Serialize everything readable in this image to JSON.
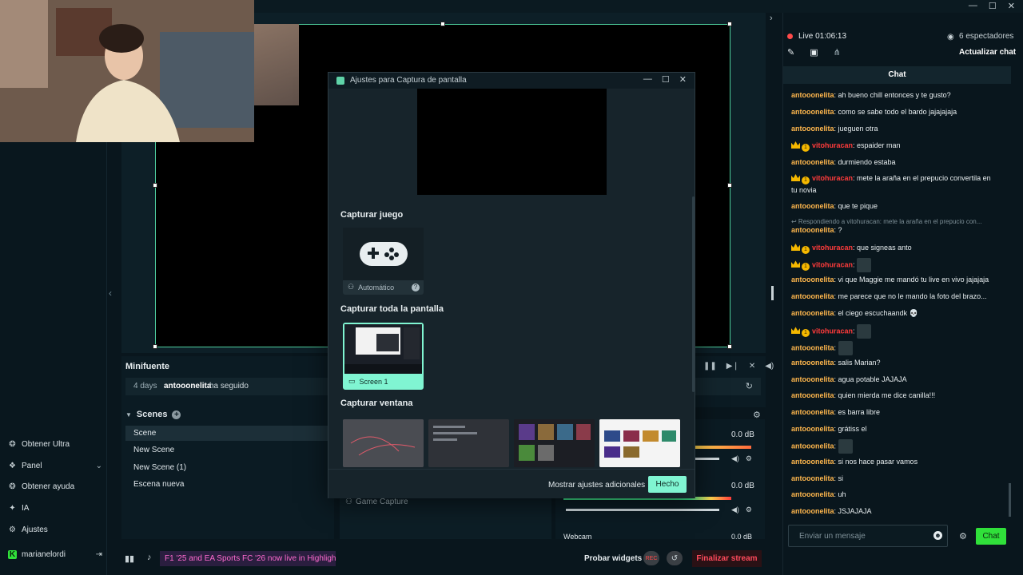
{
  "window": {
    "minimize": "—",
    "maximize": "☐",
    "close": "✕"
  },
  "nav": {
    "items": [
      {
        "label": "Obtener Ultra",
        "icon": "ultra-icon"
      },
      {
        "label": "Panel",
        "icon": "panel-icon"
      },
      {
        "label": "Obtener ayuda",
        "icon": "help-icon"
      },
      {
        "label": "IA",
        "icon": "ai-icon"
      },
      {
        "label": "Ajustes",
        "icon": "gear-icon"
      }
    ],
    "user": "marianelordi"
  },
  "minifuente": {
    "title": "Minifuente",
    "event_time": "4 days",
    "event_user": "antooonelita",
    "event_text": "ha seguido"
  },
  "scenes": {
    "title": "Scenes",
    "items": [
      "Scene",
      "New Scene",
      "New Scene (1)",
      "Escena nueva"
    ]
  },
  "sources": {
    "item": "Game Capture"
  },
  "mixer": {
    "db1": "0.0 dB",
    "db2": "0.0 dB",
    "db3": "0.0 dB",
    "label3": "Webcam"
  },
  "bottom": {
    "banner": "F1 '25 and EA Sports FC '26 now live in Highlighter!",
    "probar": "Probar widgets",
    "rec": "REC",
    "finalizar": "Finalizar stream"
  },
  "dialog": {
    "title": "Ajustes para Captura de pantalla",
    "sec_game": "Capturar juego",
    "auto": "Automático",
    "sec_screen": "Capturar toda la pantalla",
    "screen1": "Screen 1",
    "sec_window": "Capturar ventana",
    "more": "Mostrar ajustes adicionales",
    "done": "Hecho"
  },
  "chat": {
    "live": "Live 01:06:13",
    "viewers": "6 espectadores",
    "refresh": "Actualizar chat",
    "header": "Chat",
    "messages": [
      {
        "user": "antooonelita",
        "text": "ah bueno chill entonces y te gusto?"
      },
      {
        "user": "antooonelita",
        "text": "como se sabe todo el bardo jajajajaja"
      },
      {
        "user": "antooonelita",
        "text": "jueguen otra"
      },
      {
        "user": "vitohuracan",
        "text": "espaider man",
        "mod": true
      },
      {
        "user": "antooonelita",
        "text": "durmiendo estaba"
      },
      {
        "user": "vitohuracan",
        "text": "mete la araña en el prepucio convertila en",
        "text2": "tu novia",
        "mod": true
      },
      {
        "user": "antooonelita",
        "text": "que te pique"
      },
      {
        "reply": "Respondiendo a vitohuracan: mete la araña en el prepucio con..."
      },
      {
        "user": "antooonelita",
        "text": "?"
      },
      {
        "user": "vitohuracan",
        "text": "que signeas anto",
        "mod": true
      },
      {
        "user": "vitohuracan",
        "text": "",
        "mod": true,
        "emote": true
      },
      {
        "user": "antooonelita",
        "text": "vi que Maggie me mandó tu live en vivo jajajaja"
      },
      {
        "user": "antooonelita",
        "text": "me parece que no le mando la foto del brazo..."
      },
      {
        "user": "antooonelita",
        "text": "el ciego escuchaandk 💀"
      },
      {
        "user": "vitohuracan",
        "text": "",
        "mod": true,
        "emote": true
      },
      {
        "user": "antooonelita",
        "text": "",
        "emote": true
      },
      {
        "user": "antooonelita",
        "text": "salis Marian?"
      },
      {
        "user": "antooonelita",
        "text": "agua potable JAJAJA"
      },
      {
        "user": "antooonelita",
        "text": "quien mierda me dice canilla!!!"
      },
      {
        "user": "antooonelita",
        "text": "es barra libre"
      },
      {
        "user": "antooonelita",
        "text": "grátiss el"
      },
      {
        "user": "antooonelita",
        "text": "",
        "emote": true
      },
      {
        "user": "antooonelita",
        "text": "si nos hace pasar vamos"
      },
      {
        "user": "antooonelita",
        "text": "si"
      },
      {
        "user": "antooonelita",
        "text": "uh"
      },
      {
        "user": "antooonelita",
        "text": "JSJAJAJA"
      }
    ],
    "placeholder": "Enviar un mensaje",
    "send": "Chat"
  },
  "colors": {
    "accent": "#80f5d2",
    "live": "#ff4a4a",
    "username": "#ffb74d",
    "mod": "#ff3b3b",
    "send": "#30e03a"
  }
}
